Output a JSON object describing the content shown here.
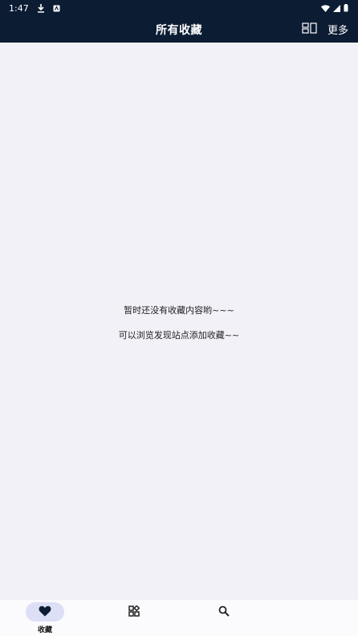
{
  "status_bar": {
    "time": "1:47",
    "icons": [
      "download-icon",
      "notification-app-icon",
      "wifi-icon",
      "signal-icon",
      "battery-icon"
    ]
  },
  "app_bar": {
    "title": "所有收藏",
    "layout_icon": "layout-toggle-icon",
    "more_label": "更多"
  },
  "empty_state": {
    "line1": "暂时还没有收藏内容哟~~~",
    "line2": "可以浏览发现站点添加收藏~~"
  },
  "bottom_nav": {
    "items": [
      {
        "label": "收藏",
        "icon": "heart-icon",
        "active": true
      },
      {
        "label": "",
        "icon": "discover-grid-icon",
        "active": false
      },
      {
        "label": "",
        "icon": "search-icon",
        "active": false
      }
    ]
  },
  "colors": {
    "app_bar_bg": "#0c1c33",
    "content_bg": "#f2f1f7",
    "nav_pill": "#dcdff5",
    "nav_active_icon": "#0c1c33"
  }
}
